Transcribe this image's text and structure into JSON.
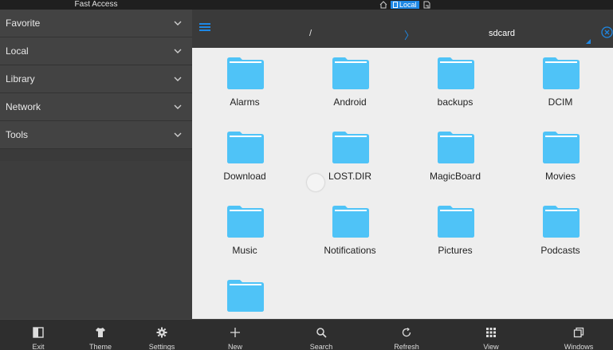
{
  "sidebar": {
    "title": "Fast Access",
    "items": [
      {
        "label": "Favorite"
      },
      {
        "label": "Local"
      },
      {
        "label": "Library"
      },
      {
        "label": "Network"
      },
      {
        "label": "Tools"
      }
    ]
  },
  "status": {
    "chip_label": "Local"
  },
  "path": {
    "root": "/",
    "separator": "〉",
    "current": "sdcard"
  },
  "files": [
    {
      "name": "Alarms"
    },
    {
      "name": "Android"
    },
    {
      "name": "backups"
    },
    {
      "name": "DCIM"
    },
    {
      "name": "Download"
    },
    {
      "name": "LOST.DIR"
    },
    {
      "name": "MagicBoard"
    },
    {
      "name": "Movies"
    },
    {
      "name": "Music"
    },
    {
      "name": "Notifications"
    },
    {
      "name": "Pictures"
    },
    {
      "name": "Podcasts"
    },
    {
      "name": ""
    }
  ],
  "toolbar": {
    "exit": "Exit",
    "theme": "Theme",
    "settings": "Settings",
    "new": "New",
    "search": "Search",
    "refresh": "Refresh",
    "view": "View",
    "windows": "Windows"
  },
  "colors": {
    "accent": "#1e88e5",
    "folder": "#4fc3f7",
    "folder_tab": "#81d4fa"
  }
}
